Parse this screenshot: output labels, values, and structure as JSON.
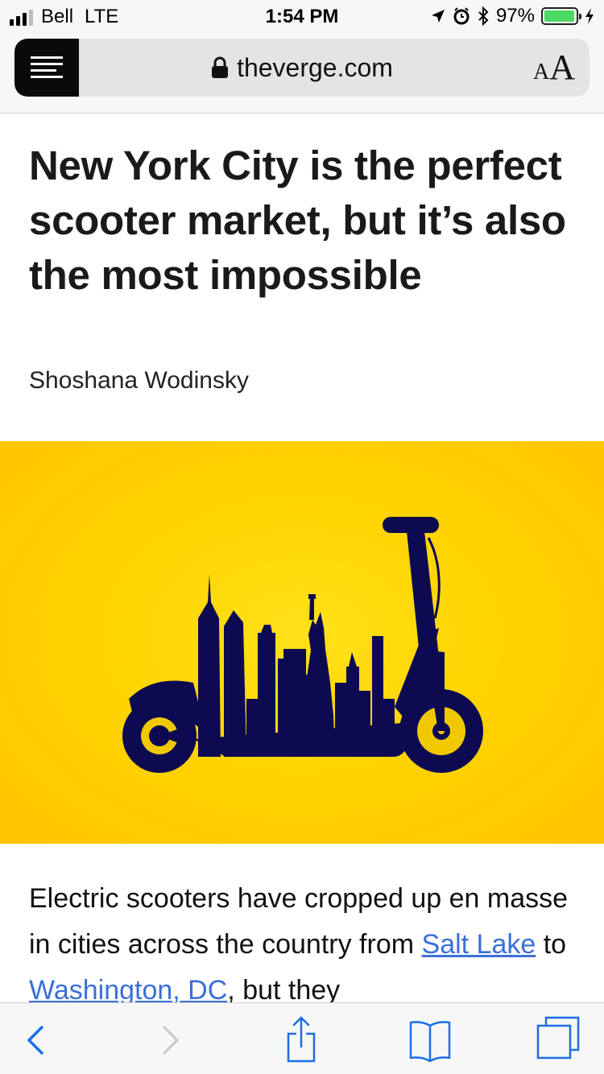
{
  "status_bar": {
    "carrier": "Bell",
    "network": "LTE",
    "time": "1:54 PM",
    "battery": "97%",
    "battery_level": 0.97,
    "battery_color": "#4cd964"
  },
  "address_bar": {
    "url": "theverge.com",
    "text_size_small": "A",
    "text_size_large": "A"
  },
  "article": {
    "headline": "New York City is the perfect scooter market, but it’s also the most impossible",
    "author": "Shoshana Wodinsky",
    "hero_colors": {
      "background": "#ffd400",
      "silhouette": "#0d0a52"
    },
    "body": {
      "intro": "Electric scooters have cropped up en masse in cities across the country from ",
      "link1": "Salt Lake",
      "mid": " to ",
      "link2": "Washington, DC",
      "tail": ", but they"
    },
    "link_color": "#3a6fd8"
  },
  "toolbar": {
    "icons": [
      "back-icon",
      "forward-icon",
      "share-icon",
      "bookmarks-icon",
      "tabs-icon"
    ]
  }
}
